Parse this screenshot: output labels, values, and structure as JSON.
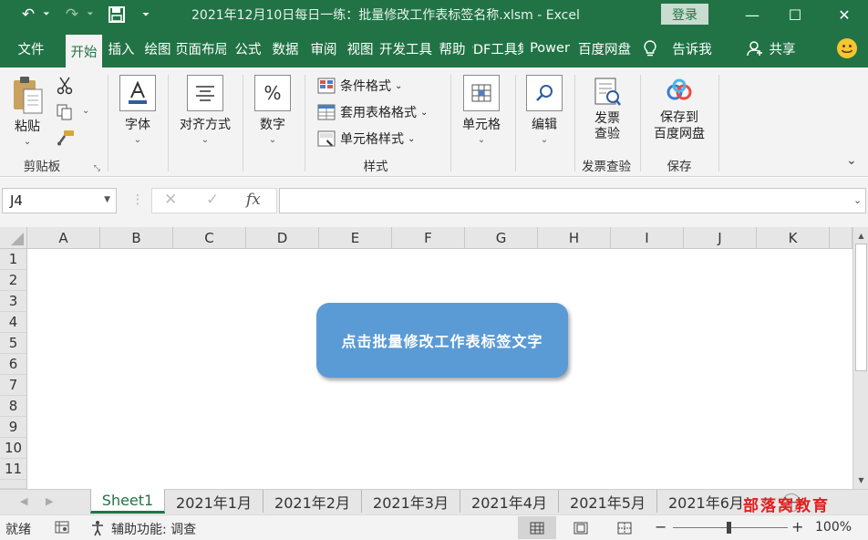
{
  "titlebar": {
    "title": "2021年12月10日每日一练：批量修改工作表标签名称.xlsm  -  Excel",
    "login_label": "登录",
    "undo_glyph": "↶",
    "redo_glyph": "↷",
    "save_glyph": "💾",
    "customize_glyph": "⏷",
    "minimize_glyph": "—",
    "restore_glyph": "☐",
    "close_glyph": "✕",
    "icon_names": [
      "undo-icon",
      "redo-icon",
      "save-icon",
      "customize-qat-icon",
      "minimize-icon",
      "restore-icon",
      "close-icon"
    ]
  },
  "tabs": [
    {
      "label": "文件"
    },
    {
      "label": "开始",
      "active": true
    },
    {
      "label": "插入"
    },
    {
      "label": "绘图"
    },
    {
      "label": "页面布局"
    },
    {
      "label": "公式"
    },
    {
      "label": "数据"
    },
    {
      "label": "审阅"
    },
    {
      "label": "视图"
    },
    {
      "label": "开发工具"
    },
    {
      "label": "帮助"
    },
    {
      "label": "PDF工具集"
    },
    {
      "label": "Power"
    },
    {
      "label": "百度网盘"
    }
  ],
  "tellme_label": "告诉我",
  "share_label": "共享",
  "ribbon": {
    "clipboard": {
      "paste": "粘贴",
      "group": "剪贴板"
    },
    "font": {
      "label": "字体"
    },
    "align": {
      "label": "对齐方式"
    },
    "number": {
      "label": "数字"
    },
    "styles": {
      "cond": "条件格式",
      "table": "套用表格格式",
      "cell": "单元格样式",
      "group": "样式"
    },
    "cells": {
      "label": "单元格"
    },
    "edit": {
      "label": "编辑"
    },
    "invoice": {
      "line1": "发票",
      "line2": "查验",
      "group": "发票查验"
    },
    "save_cloud": {
      "line1": "保存到",
      "line2": "百度网盘",
      "group": "保存"
    }
  },
  "formula_bar": {
    "namebox": "J4",
    "formula": "",
    "cancel": "✕",
    "enter": "✓",
    "fx": "fx"
  },
  "columns": [
    "A",
    "B",
    "C",
    "D",
    "E",
    "F",
    "G",
    "H",
    "I",
    "J",
    "K"
  ],
  "rows": [
    "1",
    "2",
    "3",
    "4",
    "5",
    "6",
    "7",
    "8",
    "9",
    "10",
    "11"
  ],
  "callout_text": "点击批量修改工作表标签文字",
  "sheets": [
    "Sheet1",
    "2021年1月",
    "2021年2月",
    "2021年3月",
    "2021年4月",
    "2021年5月",
    "2021年6月"
  ],
  "active_sheet": "Sheet1",
  "watermark": "部落窝教育",
  "status": {
    "ready": "就绪",
    "accessibility": "辅助功能: 调查",
    "zoom": "100%",
    "zoom_minus": "−",
    "zoom_plus": "+"
  },
  "colors": {
    "excel_green": "#217346",
    "callout_blue": "#5b9bd5",
    "watermark_red": "#e02020"
  }
}
